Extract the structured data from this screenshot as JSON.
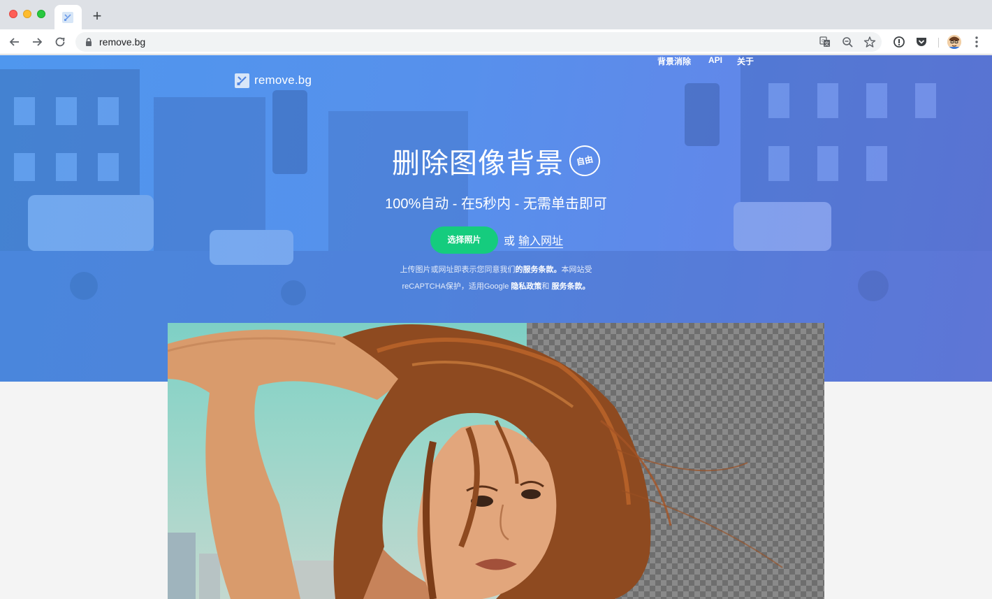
{
  "browser": {
    "url": "remove.bg",
    "newtab_label": "+"
  },
  "site": {
    "brand": "remove.bg",
    "nav": [
      "背景消除",
      "API",
      "关于"
    ],
    "headline": "删除图像背景",
    "badge": "自由",
    "subhead": "100%自动 - 在5秒内 - 无需单击即可",
    "upload_button": "选择照片",
    "or": "或",
    "url_link": "输入网址",
    "legal": {
      "line1_prefix": "上传图片或网址即表示您同意我们",
      "terms1": "的服务条款。",
      "line1_suffix": "本网站受",
      "line2_prefix": "reCAPTCHA保护，适用Google",
      "privacy": "隐私政策",
      "and": "和",
      "terms2": "服务条款。"
    }
  },
  "colors": {
    "hero_start": "#4f97ee",
    "hero_end": "#6b7fe6",
    "upload_button": "#15cc7e"
  },
  "icons": [
    "back-arrow-icon",
    "forward-arrow-icon",
    "reload-icon",
    "lock-icon",
    "translate-icon",
    "zoom-out-icon",
    "star-icon",
    "info-extension-icon",
    "pocket-extension-icon",
    "profile-avatar",
    "menu-dots-icon",
    "remove-bg-logo-icon"
  ]
}
